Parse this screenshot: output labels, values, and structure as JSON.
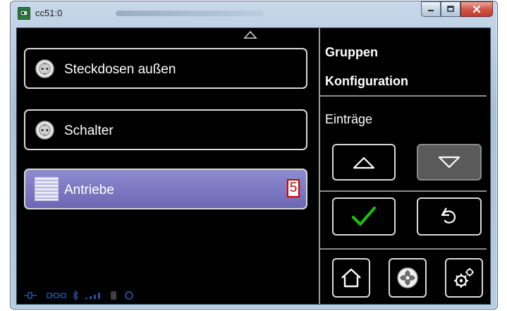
{
  "window": {
    "title": "cc51:0",
    "controls": {
      "minimize_icon": "minimize-icon",
      "maximize_icon": "maximize-icon",
      "close_icon": "close-icon"
    }
  },
  "list": {
    "items": [
      {
        "label": "Steckdosen außen",
        "icon": "socket-icon"
      },
      {
        "label": "Schalter",
        "icon": "socket-icon"
      },
      {
        "label": "Antriebe",
        "icon": "blind-icon",
        "badge": "5",
        "selected": true
      }
    ]
  },
  "sidebar": {
    "heading_line1": "Gruppen",
    "heading_line2": "Konfiguration",
    "section_label": "Einträge",
    "buttons": {
      "up": "up-arrow-icon",
      "down": "down-arrow-icon",
      "confirm": "checkmark-icon",
      "back": "back-icon",
      "home": "home-icon",
      "fan": "fan-icon",
      "settings": "settings-icon"
    }
  },
  "colors": {
    "selected_item": "#7a76c2",
    "badge_red": "#d10000",
    "confirm_green": "#19c40f",
    "status_blue": "#2f6bd6"
  }
}
